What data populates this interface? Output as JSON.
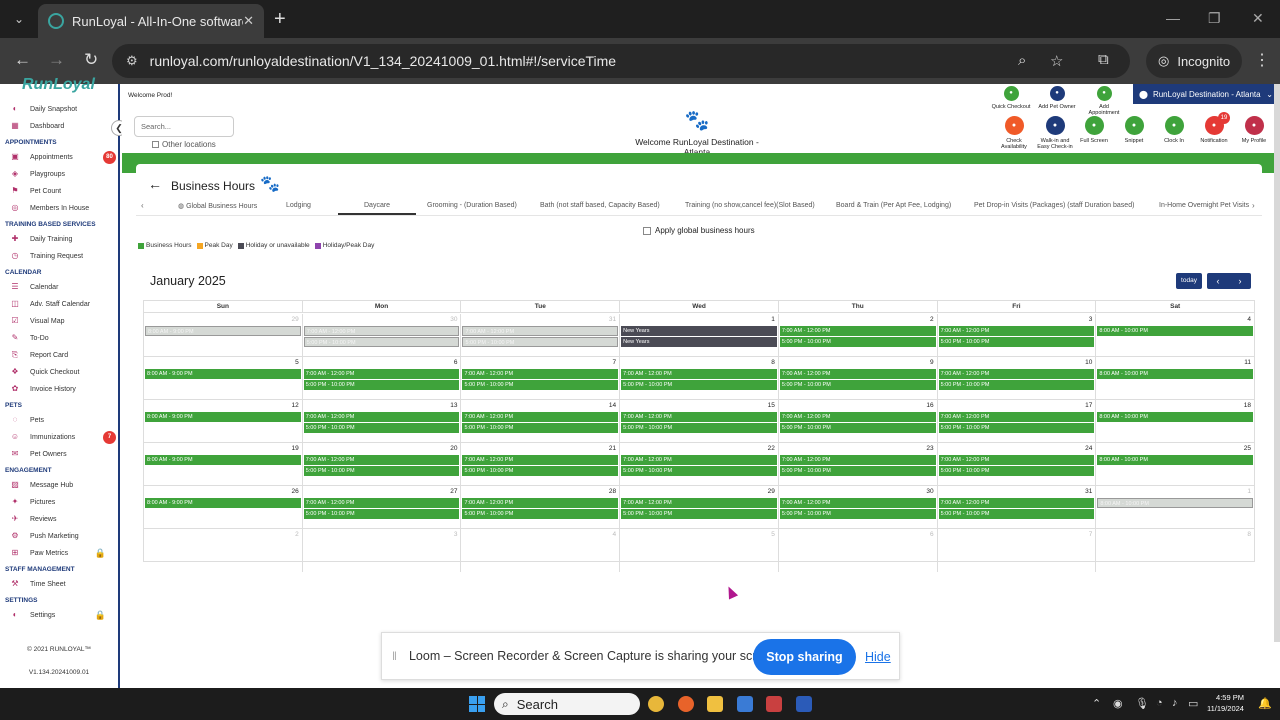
{
  "browser": {
    "tab_title": "RunLoyal - All-In-One software",
    "url": "runloyal.com/runloyaldestination/V1_134_20241009_01.html#!/serviceTime",
    "incognito_label": "Incognito"
  },
  "sidebar": {
    "logo": "RunLoyal",
    "items_top": [
      {
        "label": "Daily Snapshot",
        "icon": "camera-icon"
      },
      {
        "label": "Dashboard",
        "icon": "dashboard-icon"
      }
    ],
    "sections": [
      {
        "heading": "APPOINTMENTS",
        "items": [
          {
            "label": "Appointments",
            "badge": "80"
          },
          {
            "label": "Playgroups"
          },
          {
            "label": "Pet Count"
          },
          {
            "label": "Members In House"
          }
        ]
      },
      {
        "heading": "TRAINING BASED SERVICES",
        "items": [
          {
            "label": "Daily Training"
          },
          {
            "label": "Training Request"
          }
        ]
      },
      {
        "heading": "CALENDAR",
        "items": [
          {
            "label": "Calendar"
          },
          {
            "label": "Adv. Staff Calendar"
          },
          {
            "label": "Visual Map"
          },
          {
            "label": "To-Do"
          },
          {
            "label": "Report Card"
          },
          {
            "label": "Quick Checkout"
          },
          {
            "label": "Invoice History"
          }
        ]
      },
      {
        "heading": "PETS",
        "items": [
          {
            "label": "Pets"
          },
          {
            "label": "Immunizations",
            "badge": "7"
          },
          {
            "label": "Pet Owners"
          }
        ]
      },
      {
        "heading": "ENGAGEMENT",
        "items": [
          {
            "label": "Message Hub"
          },
          {
            "label": "Pictures"
          },
          {
            "label": "Reviews"
          },
          {
            "label": "Push Marketing"
          },
          {
            "label": "Paw Metrics",
            "locked": true
          }
        ]
      },
      {
        "heading": "STAFF MANAGEMENT",
        "items": [
          {
            "label": "Time Sheet"
          }
        ]
      },
      {
        "heading": "SETTINGS",
        "items": [
          {
            "label": "Settings",
            "locked": true
          }
        ]
      }
    ],
    "copyright": "© 2021 RUNLOYAL™",
    "version": "V1.134.20241009.01"
  },
  "header": {
    "welcome_user": "Welcome Prod!",
    "search_placeholder": "Search...",
    "other_locations": "Other locations",
    "welcome_center": "Welcome RunLoyal Destination - Atlanta",
    "location": "RunLoyal Destination - Atlanta",
    "actions_top": [
      {
        "label": "Quick Checkout",
        "color": "#3fa33b"
      },
      {
        "label": "Add Pet Owner",
        "color": "#1e3a7a"
      },
      {
        "label": "Add Appointment",
        "color": "#3fa33b"
      }
    ],
    "actions_bottom": [
      {
        "label": "Check Availability",
        "color": "#f05a28"
      },
      {
        "label": "Walk-in and Easy Check-in",
        "color": "#1e3a7a"
      },
      {
        "label": "Full Screen",
        "color": "#3fa33b"
      },
      {
        "label": "Snippet",
        "color": "#3fa33b"
      },
      {
        "label": "Clock In",
        "color": "#3fa33b"
      },
      {
        "label": "Notification",
        "color": "#e53935",
        "badge": "19"
      },
      {
        "label": "My Profile",
        "color": "#c0304a"
      }
    ]
  },
  "page": {
    "title": "Business Hours",
    "tabs": [
      "Global Business Hours",
      "Lodging",
      "Daycare",
      "Grooming - (Duration Based)",
      "Bath (not staff based, Capacity Based)",
      "Training (no show,cancel fee)(Slot Based)",
      "Board & Train (Per Apt Fee, Lodging)",
      "Pet Drop-in Visits (Packages) (staff Duration based)",
      "In-Home Overnight Pet Visits"
    ],
    "active_tab": "Daycare",
    "apply_global": "Apply global business hours",
    "legend": [
      {
        "label": "Business Hours",
        "color": "#3fa33b"
      },
      {
        "label": "Peak Day",
        "color": "#f5a623"
      },
      {
        "label": "Holiday or unavailable",
        "color": "#4b4b55"
      },
      {
        "label": "Holiday/Peak Day",
        "color": "#8e44ad"
      }
    ],
    "month": "January 2025",
    "today_label": "today"
  },
  "calendar": {
    "weekdays": [
      "Sun",
      "Mon",
      "Tue",
      "Wed",
      "Thu",
      "Fri",
      "Sat"
    ],
    "weeks": [
      [
        {
          "day": "29",
          "other": true,
          "events": [
            {
              "t": "8:00 AM - 9:00 PM",
              "k": "gray"
            }
          ]
        },
        {
          "day": "30",
          "other": true,
          "events": [
            {
              "t": "7:00 AM - 12:00 PM",
              "k": "gray"
            },
            {
              "t": "5:00 PM - 10:00 PM",
              "k": "gray"
            }
          ]
        },
        {
          "day": "31",
          "other": true,
          "events": [
            {
              "t": "7:00 AM - 12:00 PM",
              "k": "gray"
            },
            {
              "t": "5:00 PM - 10:00 PM",
              "k": "gray"
            }
          ]
        },
        {
          "day": "1",
          "events": [
            {
              "t": "New Years",
              "k": "dark"
            },
            {
              "t": "New Years",
              "k": "dark"
            }
          ]
        },
        {
          "day": "2",
          "events": [
            {
              "t": "7:00 AM - 12:00 PM",
              "k": "green"
            },
            {
              "t": "5:00 PM - 10:00 PM",
              "k": "green"
            }
          ]
        },
        {
          "day": "3",
          "events": [
            {
              "t": "7:00 AM - 12:00 PM",
              "k": "green"
            },
            {
              "t": "5:00 PM - 10:00 PM",
              "k": "green"
            }
          ]
        },
        {
          "day": "4",
          "events": [
            {
              "t": "8:00 AM - 10:00 PM",
              "k": "green"
            }
          ]
        }
      ],
      [
        {
          "day": "5",
          "events": [
            {
              "t": "8:00 AM - 9:00 PM",
              "k": "green"
            }
          ]
        },
        {
          "day": "6",
          "events": [
            {
              "t": "7:00 AM - 12:00 PM",
              "k": "green"
            },
            {
              "t": "5:00 PM - 10:00 PM",
              "k": "green"
            }
          ]
        },
        {
          "day": "7",
          "events": [
            {
              "t": "7:00 AM - 12:00 PM",
              "k": "green"
            },
            {
              "t": "5:00 PM - 10:00 PM",
              "k": "green"
            }
          ]
        },
        {
          "day": "8",
          "events": [
            {
              "t": "7:00 AM - 12:00 PM",
              "k": "green"
            },
            {
              "t": "5:00 PM - 10:00 PM",
              "k": "green"
            }
          ]
        },
        {
          "day": "9",
          "events": [
            {
              "t": "7:00 AM - 12:00 PM",
              "k": "green"
            },
            {
              "t": "5:00 PM - 10:00 PM",
              "k": "green"
            }
          ]
        },
        {
          "day": "10",
          "events": [
            {
              "t": "7:00 AM - 12:00 PM",
              "k": "green"
            },
            {
              "t": "5:00 PM - 10:00 PM",
              "k": "green"
            }
          ]
        },
        {
          "day": "11",
          "events": [
            {
              "t": "8:00 AM - 10:00 PM",
              "k": "green"
            }
          ]
        }
      ],
      [
        {
          "day": "12",
          "events": [
            {
              "t": "8:00 AM - 9:00 PM",
              "k": "green"
            }
          ]
        },
        {
          "day": "13",
          "events": [
            {
              "t": "7:00 AM - 12:00 PM",
              "k": "green"
            },
            {
              "t": "5:00 PM - 10:00 PM",
              "k": "green"
            }
          ]
        },
        {
          "day": "14",
          "events": [
            {
              "t": "7:00 AM - 12:00 PM",
              "k": "green"
            },
            {
              "t": "5:00 PM - 10:00 PM",
              "k": "green"
            }
          ]
        },
        {
          "day": "15",
          "events": [
            {
              "t": "7:00 AM - 12:00 PM",
              "k": "green"
            },
            {
              "t": "5:00 PM - 10:00 PM",
              "k": "green"
            }
          ]
        },
        {
          "day": "16",
          "events": [
            {
              "t": "7:00 AM - 12:00 PM",
              "k": "green"
            },
            {
              "t": "5:00 PM - 10:00 PM",
              "k": "green"
            }
          ]
        },
        {
          "day": "17",
          "events": [
            {
              "t": "7:00 AM - 12:00 PM",
              "k": "green"
            },
            {
              "t": "5:00 PM - 10:00 PM",
              "k": "green"
            }
          ]
        },
        {
          "day": "18",
          "events": [
            {
              "t": "8:00 AM - 10:00 PM",
              "k": "green"
            }
          ]
        }
      ],
      [
        {
          "day": "19",
          "events": [
            {
              "t": "8:00 AM - 9:00 PM",
              "k": "green"
            }
          ]
        },
        {
          "day": "20",
          "events": [
            {
              "t": "7:00 AM - 12:00 PM",
              "k": "green"
            },
            {
              "t": "5:00 PM - 10:00 PM",
              "k": "green"
            }
          ]
        },
        {
          "day": "21",
          "events": [
            {
              "t": "7:00 AM - 12:00 PM",
              "k": "green"
            },
            {
              "t": "5:00 PM - 10:00 PM",
              "k": "green"
            }
          ]
        },
        {
          "day": "22",
          "events": [
            {
              "t": "7:00 AM - 12:00 PM",
              "k": "green"
            },
            {
              "t": "5:00 PM - 10:00 PM",
              "k": "green"
            }
          ]
        },
        {
          "day": "23",
          "events": [
            {
              "t": "7:00 AM - 12:00 PM",
              "k": "green"
            },
            {
              "t": "5:00 PM - 10:00 PM",
              "k": "green"
            }
          ]
        },
        {
          "day": "24",
          "events": [
            {
              "t": "7:00 AM - 12:00 PM",
              "k": "green"
            },
            {
              "t": "5:00 PM - 10:00 PM",
              "k": "green"
            }
          ]
        },
        {
          "day": "25",
          "events": [
            {
              "t": "8:00 AM - 10:00 PM",
              "k": "green"
            }
          ]
        }
      ],
      [
        {
          "day": "26",
          "events": [
            {
              "t": "8:00 AM - 9:00 PM",
              "k": "green"
            }
          ]
        },
        {
          "day": "27",
          "events": [
            {
              "t": "7:00 AM - 12:00 PM",
              "k": "green"
            },
            {
              "t": "5:00 PM - 10:00 PM",
              "k": "green"
            }
          ]
        },
        {
          "day": "28",
          "events": [
            {
              "t": "7:00 AM - 12:00 PM",
              "k": "green"
            },
            {
              "t": "5:00 PM - 10:00 PM",
              "k": "green"
            }
          ]
        },
        {
          "day": "29",
          "events": [
            {
              "t": "7:00 AM - 12:00 PM",
              "k": "green"
            },
            {
              "t": "5:00 PM - 10:00 PM",
              "k": "green"
            }
          ]
        },
        {
          "day": "30",
          "events": [
            {
              "t": "7:00 AM - 12:00 PM",
              "k": "green"
            },
            {
              "t": "5:00 PM - 10:00 PM",
              "k": "green"
            }
          ]
        },
        {
          "day": "31",
          "events": [
            {
              "t": "7:00 AM - 12:00 PM",
              "k": "green"
            },
            {
              "t": "5:00 PM - 10:00 PM",
              "k": "green"
            }
          ]
        },
        {
          "day": "1",
          "other": true,
          "events": [
            {
              "t": "8:00 AM - 10:00 PM",
              "k": "gray"
            }
          ]
        }
      ],
      [
        {
          "day": "2",
          "other": true,
          "events": []
        },
        {
          "day": "3",
          "other": true,
          "events": []
        },
        {
          "day": "4",
          "other": true,
          "events": []
        },
        {
          "day": "5",
          "other": true,
          "events": []
        },
        {
          "day": "6",
          "other": true,
          "events": []
        },
        {
          "day": "7",
          "other": true,
          "events": []
        },
        {
          "day": "8",
          "other": true,
          "events": []
        }
      ]
    ]
  },
  "loom": {
    "message": "Loom – Screen Recorder & Screen Capture is sharing your screen.",
    "stop_label": "Stop sharing",
    "hide_label": "Hide"
  },
  "taskbar": {
    "search_label": "Search",
    "time": "4:59 PM",
    "date": "11/19/2024"
  }
}
